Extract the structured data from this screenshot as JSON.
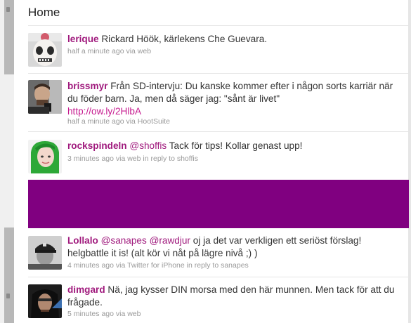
{
  "page": {
    "title": "Home"
  },
  "colors": {
    "accent": "#a01a7d",
    "promo_block": "#800080"
  },
  "tweets": [
    {
      "user": "lerique",
      "text": "Rickard Höök, kärlekens Che Guevara.",
      "meta": "half a minute ago via web",
      "avatar": "clown-avatar"
    },
    {
      "user": "brissmyr",
      "text": "Från SD-intervju: Du kanske kommer efter i någon sorts karriär när du föder barn. Ja, men då säger jag: \"sånt är livet\"",
      "link": "http://ow.ly/2HlbA",
      "meta": "half a minute ago via HootSuite",
      "avatar": "man-with-phone-avatar"
    },
    {
      "user": "rockspindeln",
      "mention": "@shoffis",
      "text": "Tack för tips! Kollar genast upp!",
      "meta": "3 minutes ago via web in reply to shoffis",
      "avatar": "green-hair-woman-avatar"
    },
    {
      "user": "Lollalo",
      "mention": "@sanapes",
      "mention2": "@rawdjur",
      "text": "oj ja det var verkligen ett seriöst förslag! helgbattle it is! (alt kör vi nåt på lägre nivå ;) )",
      "meta": "4 minutes ago via Twitter for iPhone in reply to sanapes",
      "avatar": "cap-person-avatar"
    },
    {
      "user": "dimgard",
      "text": "Nä, jag kysser DIN morsa med den här munnen. Men tack för att du frågade.",
      "meta": "5 minutes ago via web",
      "avatar": "hooded-man-avatar"
    }
  ]
}
